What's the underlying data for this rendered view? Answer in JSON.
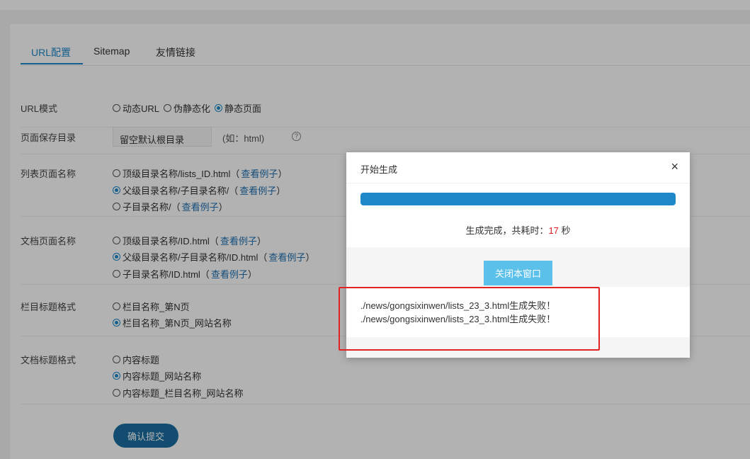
{
  "tabs": [
    {
      "label": "URL配置"
    },
    {
      "label": "Sitemap"
    },
    {
      "label": "友情链接"
    }
  ],
  "form": {
    "url_mode": {
      "label": "URL模式",
      "options": [
        "动态URL",
        "伪静态化",
        "静态页面"
      ],
      "selected": 2
    },
    "save_dir": {
      "label": "页面保存目录",
      "placeholder": "留空默认根目录",
      "hint": "(如：html)"
    },
    "list_page": {
      "label": "列表页面名称",
      "options": [
        "顶级目录名称/lists_ID.html",
        "父级目录名称/子目录名称/",
        "子目录名称/"
      ],
      "selected": 1
    },
    "doc_page": {
      "label": "文档页面名称",
      "options": [
        "顶级目录名称/ID.html",
        "父级目录名称/子目录名称/ID.html",
        "子目录名称/ID.html"
      ],
      "selected": 1
    },
    "column_title": {
      "label": "栏目标题格式",
      "options": [
        "栏目名称_第N页",
        "栏目名称_第N页_网站名称"
      ],
      "selected": 1
    },
    "doc_title": {
      "label": "文档标题格式",
      "options": [
        "内容标题",
        "内容标题_网站名称",
        "内容标题_栏目名称_网站名称"
      ],
      "selected": 1
    },
    "example_link": "查看例子",
    "submit_label": "确认提交"
  },
  "modal": {
    "title": "开始生成",
    "close_glyph": "×",
    "progress": 1.0,
    "status_prefix": "生成完成，共耗时：",
    "status_seconds": "17",
    "status_suffix": " 秒",
    "close_button": "关闭本窗口",
    "log": [
      "./news/gongsixinwen/lists_23_3.html生成失败！",
      "./news/gongsixinwen/lists_23_3.html生成失败！"
    ]
  },
  "colors": {
    "accent": "#1e88c9",
    "link": "#1e6fb0",
    "submit": "#1a6fa3",
    "modal_button": "#5bc0ea",
    "time_highlight": "#e02020",
    "annotation_box": "#e02424"
  }
}
